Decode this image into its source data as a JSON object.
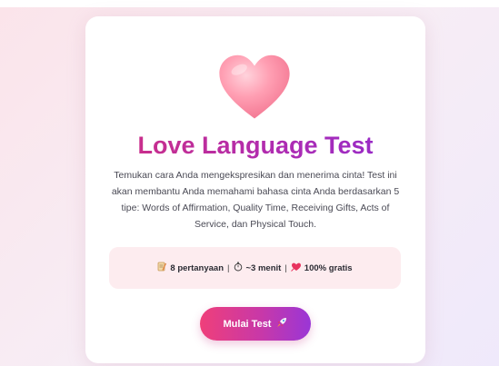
{
  "page": {
    "title": "Love Language Test",
    "description": "Temukan cara Anda mengekspresikan dan menerima cinta! Test ini akan membantu Anda memahami bahasa cinta Anda berdasarkan 5 tipe: Words of Affirmation, Quality Time, Receiving Gifts, Acts of Service, dan Physical Touch."
  },
  "icons": {
    "hero": "heart-icon",
    "questions": "memo-icon",
    "duration": "stopwatch-icon",
    "free": "love-letter-heart-icon",
    "start": "rocket-icon"
  },
  "info": {
    "questions": "8 pertanyaan",
    "duration": "~3 menit",
    "free": "100% gratis",
    "separator": "|"
  },
  "start_button": {
    "label": "Mulai Test"
  },
  "colors": {
    "title_gradient_start": "#d22f7e",
    "title_gradient_end": "#8f2ad0",
    "button_gradient_start": "#ef3f7a",
    "button_gradient_end": "#9a36d6",
    "info_box_bg": "#fdecef",
    "heart": "#ff8fa6"
  }
}
